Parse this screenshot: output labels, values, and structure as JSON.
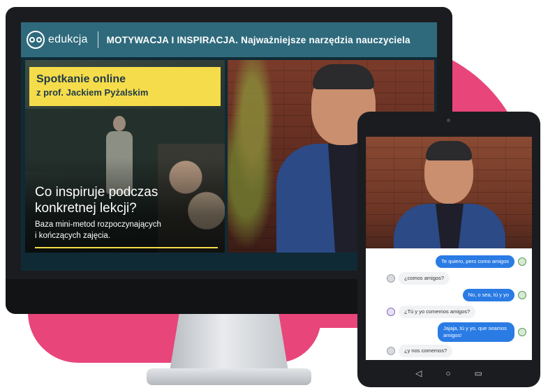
{
  "header": {
    "logo_text": "edukcja",
    "title": "MOTYWACJA I INSPIRACJA. Najważniejsze narzędzia nauczyciela"
  },
  "slide": {
    "badge_line1": "Spotkanie online",
    "badge_line2": "z prof. Jackiem Pyżalskim",
    "title_line1": "Co inspiruje podczas",
    "title_line2": "konkretnej lekcji?",
    "subtitle_line1": "Baza mini-metod rozpoczynających",
    "subtitle_line2": "i kończących zajęcia."
  },
  "chat": {
    "messages": [
      {
        "text": "Te quiero, pero como amigos",
        "side": "out",
        "avatar": "owl-icon"
      },
      {
        "text": "¿comos amigos?",
        "side": "in",
        "avatar": "user-grey-icon"
      },
      {
        "text": "No, o sea, tú y yo",
        "side": "out",
        "avatar": "owl-icon"
      },
      {
        "text": "¿Tú y yo comemos amigos?",
        "side": "in",
        "avatar": "user-purple-icon"
      },
      {
        "text": "Jajaja, tú y yo, que seamos amigos!",
        "side": "out",
        "avatar": "owl-icon"
      },
      {
        "text": "¿y nos comemos?",
        "side": "in",
        "avatar": "user-grey-icon"
      }
    ]
  },
  "tablet_nav": {
    "back": "◁",
    "home": "○",
    "recent": "▭"
  },
  "colors": {
    "accent_pink": "#e8457a",
    "header_teal": "#2f6a7c",
    "badge_yellow": "#f5dc4a",
    "chat_blue": "#2a7be4"
  }
}
